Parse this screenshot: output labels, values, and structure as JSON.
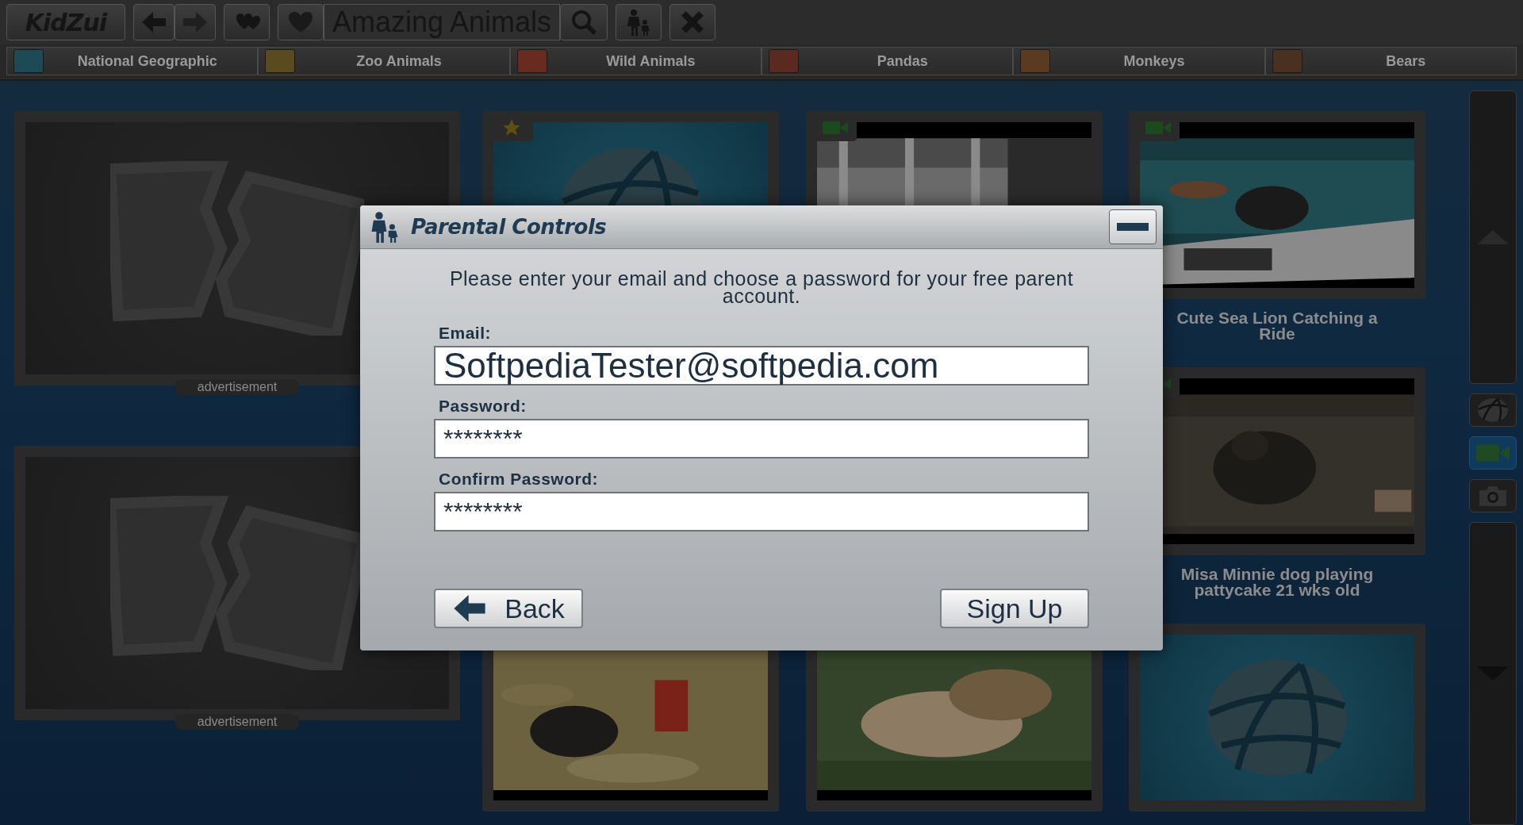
{
  "toolbar": {
    "logo": "KidZui",
    "title": "Amazing Animals"
  },
  "categories": [
    {
      "label": "National Geographic"
    },
    {
      "label": "Zoo Animals"
    },
    {
      "label": "Wild Animals"
    },
    {
      "label": "Pandas"
    },
    {
      "label": "Monkeys"
    },
    {
      "label": "Bears"
    }
  ],
  "ads": [
    {
      "label": "advertisement"
    },
    {
      "label": "advertisement"
    }
  ],
  "cards": [
    {
      "kind": "globe",
      "badge": true
    },
    {
      "kind": "video",
      "badge": true
    },
    {
      "kind": "video",
      "badge": true,
      "title": "Cute Sea Lion Catching a Ride"
    },
    {
      "kind": "video",
      "badge": true,
      "title": "Misa Minnie dog playing pattycake 21 wks old"
    },
    {
      "kind": "video",
      "badge": false
    },
    {
      "kind": "video",
      "badge": false
    },
    {
      "kind": "globe",
      "badge": false
    }
  ],
  "sidebar": {
    "buttons": [
      {
        "kind": "globe",
        "selected": false
      },
      {
        "kind": "video",
        "selected": true
      },
      {
        "kind": "camera",
        "selected": false
      }
    ]
  },
  "dialog": {
    "title": "Parental Controls",
    "message": "Please enter your email and choose a password for your free parent account.",
    "fields": [
      {
        "label": "Email:",
        "value": "SoftpediaTester@softpedia.com",
        "kind": "text"
      },
      {
        "label": "Password:",
        "value": "********",
        "kind": "password"
      },
      {
        "label": "Confirm Password:",
        "value": "********",
        "kind": "password"
      }
    ],
    "buttons": [
      {
        "label": "Back",
        "kind": "back"
      },
      {
        "label": "Sign Up",
        "kind": "submit"
      }
    ]
  }
}
